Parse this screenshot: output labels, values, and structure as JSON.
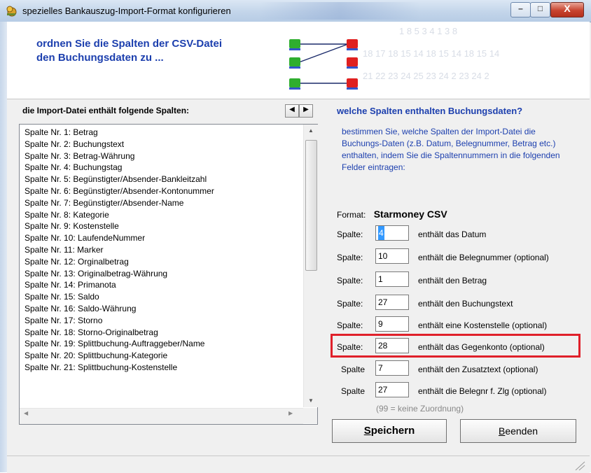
{
  "window": {
    "title": "spezielles Bankauszug-Import-Format konfigurieren",
    "min_glyph": "–",
    "max_glyph": "□",
    "close_glyph": "X"
  },
  "banner": {
    "line1": "ordnen Sie die Spalten der CSV-Datei",
    "line2": "den Buchungsdaten zu ..."
  },
  "left": {
    "title": "die Import-Datei enthält folgende Spalten:",
    "columns": [
      "Spalte Nr. 1: Betrag",
      "Spalte Nr. 2: Buchungstext",
      "Spalte Nr. 3: Betrag-Währung",
      "Spalte Nr. 4: Buchungstag",
      "Spalte Nr. 5: Begünstigter/Absender-Bankleitzahl",
      "Spalte Nr. 6: Begünstigter/Absender-Kontonummer",
      "Spalte Nr. 7: Begünstigter/Absender-Name",
      "Spalte Nr. 8: Kategorie",
      "Spalte Nr. 9: Kostenstelle",
      "Spalte Nr. 10: LaufendeNummer",
      "Spalte Nr. 11: Marker",
      "Spalte Nr. 12: Orginalbetrag",
      "Spalte Nr. 13: Originalbetrag-Währung",
      "Spalte Nr. 14: Primanota",
      "Spalte Nr. 15: Saldo",
      "Spalte Nr. 16: Saldo-Währung",
      "Spalte Nr. 17: Storno",
      "Spalte Nr. 18: Storno-Originalbetrag",
      "Spalte Nr. 19: Splittbuchung-Auftraggeber/Name",
      "Spalte Nr. 20: Splittbuchung-Kategorie",
      "Spalte Nr. 21: Splittbuchung-Kostenstelle"
    ]
  },
  "right": {
    "title": "welche Spalten enthalten Buchungsdaten?",
    "desc": "bestimmen Sie, welche Spalten der Import-Datei die Buchungs-Daten (z.B. Datum, Belegnummer, Betrag etc.) enthalten, indem Sie die Spaltennummern in die folgenden Felder eintragen:",
    "format_label": "Format:",
    "format_value": "Starmoney CSV",
    "mappings": [
      {
        "label": "Spalte:",
        "value": "4",
        "desc": "enthält das Datum"
      },
      {
        "label": "Spalte:",
        "value": "10",
        "desc": "enthält die Belegnummer (optional)"
      },
      {
        "label": "Spalte:",
        "value": "1",
        "desc": "enthält den Betrag"
      },
      {
        "label": "Spalte:",
        "value": "27",
        "desc": "enthält den Buchungstext"
      },
      {
        "label": "Spalte:",
        "value": "9",
        "desc": "enthält eine Kostenstelle (optional)"
      },
      {
        "label": "Spalte:",
        "value": "28",
        "desc": "enthält das Gegenkonto (optional)"
      },
      {
        "label": "Spalte",
        "value": "7",
        "desc": "enthält den Zusatztext (optional)"
      },
      {
        "label": "Spalte",
        "value": "27",
        "desc": "enthält die Belegnr f. Zlg (optional)"
      }
    ],
    "hint": "(99 = keine Zuordnung)"
  },
  "buttons": {
    "save_first": "S",
    "save_rest": "peichern",
    "close_first": "B",
    "close_rest": "eenden"
  },
  "colors": {
    "accent_blue": "#1c3fae",
    "highlight_red": "#e0202a"
  }
}
